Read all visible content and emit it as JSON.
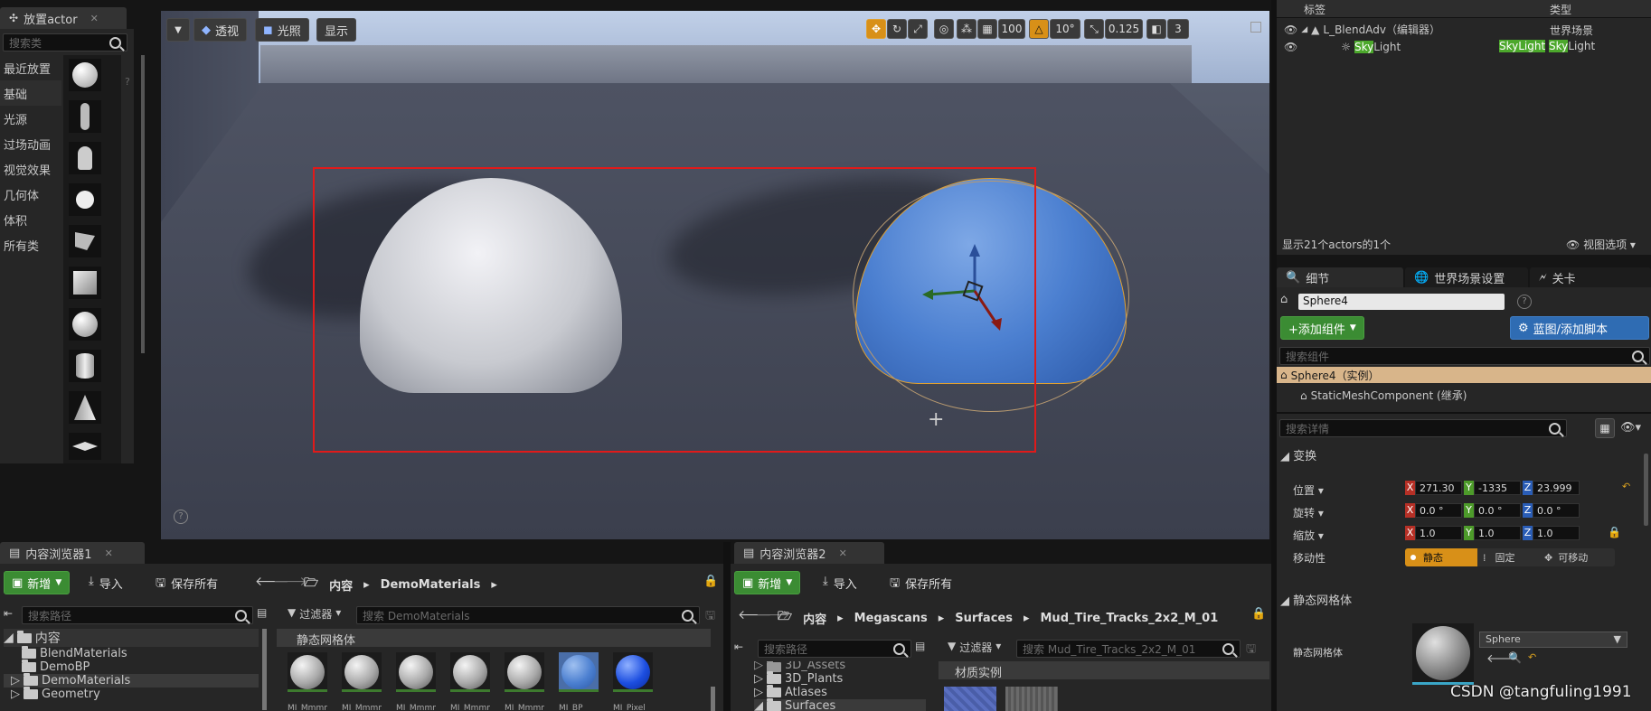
{
  "place_actors": {
    "tab_title": "放置actor",
    "search_placeholder": "搜索类",
    "categories": [
      "最近放置",
      "基础",
      "光源",
      "过场动画",
      "视觉效果",
      "几何体",
      "体积",
      "所有类"
    ],
    "selected_category": "基础"
  },
  "viewport": {
    "perspective_label": "透视",
    "lit_label": "光照",
    "show_label": "显示",
    "grid_snap": "100",
    "rotation_snap": "10°",
    "scale_snap": "0.125",
    "camera_speed": "3"
  },
  "outliner": {
    "col_label": "标签",
    "col_type": "类型",
    "rows": [
      {
        "name": "L_BlendAdv（编辑器）",
        "type": "世界场景"
      },
      {
        "name_hl": "Sky",
        "name_rest": "Light",
        "type_hl1": "SkyLight",
        "type_hl2": "Sky",
        "type_rest": "Light"
      }
    ],
    "status": "显示21个actors的1个",
    "view_options": "视图选项"
  },
  "details": {
    "tabs": [
      "细节",
      "世界场景设置",
      "关卡"
    ],
    "actor_name": "Sphere4",
    "add_component": "+添加组件",
    "blueprint": "蓝图/添加脚本",
    "search_components": "搜索组件",
    "component_root": "Sphere4（实例）",
    "component_child": "StaticMeshComponent (继承)",
    "search_details": "搜索详情",
    "transform_section": "变换",
    "location_label": "位置",
    "rotation_label": "旋转",
    "scale_label": "缩放",
    "mobility_label": "移动性",
    "location": [
      "271.30",
      "-1335",
      "23.999"
    ],
    "rotation": [
      "0.0 °",
      "0.0 °",
      "0.0 °"
    ],
    "scale": [
      "1.0",
      "1.0",
      "1.0"
    ],
    "mobility_options": [
      "静态",
      "固定",
      "可移动"
    ],
    "static_mesh_section": "静态网格体",
    "static_mesh_label": "静态网格体",
    "static_mesh_value": "Sphere"
  },
  "cb1": {
    "tab_title": "内容浏览器1",
    "add_new": "新增",
    "import": "导入",
    "save_all": "保存所有",
    "path_root": "内容",
    "path_current": "DemoMaterials",
    "search_paths": "搜索路径",
    "filters": "过滤器",
    "search_assets": "搜索 DemoMaterials",
    "tree": [
      "内容",
      "BlendMaterials",
      "DemoBP",
      "DemoMaterials",
      "Geometry"
    ],
    "group_title": "静态网格体",
    "asset_labels": [
      "MI_Mmmm",
      "MI_Mmmm",
      "MI_Mmmm",
      "MI_Mmmm",
      "MI_Mmmm",
      "MI_BP",
      "MI_Pixel"
    ]
  },
  "cb2": {
    "tab_title": "内容浏览器2",
    "add_new": "新增",
    "import": "导入",
    "save_all": "保存所有",
    "path": [
      "内容",
      "Megascans",
      "Surfaces",
      "Mud_Tire_Tracks_2x2_M_01"
    ],
    "search_paths": "搜索路径",
    "filters": "过滤器",
    "search_assets": "搜索 Mud_Tire_Tracks_2x2_M_01",
    "tree": [
      "3D_Assets",
      "3D_Plants",
      "Atlases",
      "Surfaces"
    ],
    "group_title": "材质实例"
  },
  "watermark": "CSDN @tangfuling1991",
  "colors": {
    "accent_green": "#3b8c33",
    "accent_blue": "#2f6cb3",
    "selection_red": "#e01a1a",
    "sky": "#b8c9e4"
  }
}
